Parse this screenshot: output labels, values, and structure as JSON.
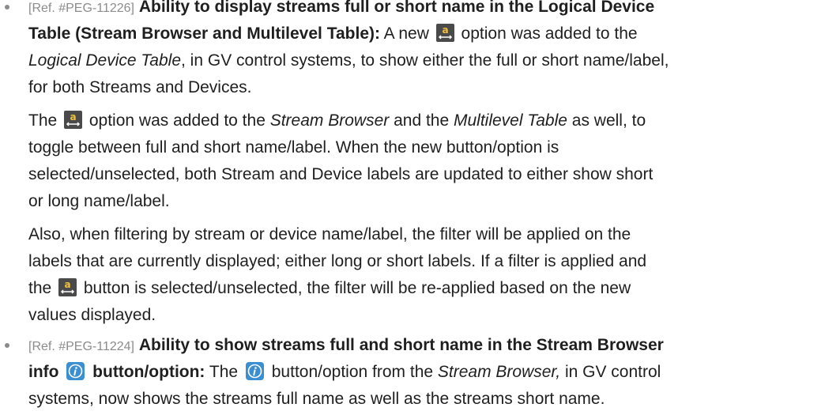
{
  "items": [
    {
      "ref": "[Ref. #PEG-11226]",
      "title_line1": "Ability to display streams full or short name in the Logical Device",
      "title_line2": "Table (Stream Browser and Multilevel Table):",
      "p1_l2_after_title_a": " A new ",
      "p1_l2_after_icon": " option was added to the",
      "p1_l3_italic": "Logical Device Table",
      "p1_l3_rest": ", in GV control systems, to show either the full or short name/label,",
      "p1_l4": "for both Streams and Devices.",
      "p2_l1_a": "The ",
      "p2_l1_b": " option was added to the ",
      "p2_l1_italic1": "Stream Browser",
      "p2_l1_c": " and the ",
      "p2_l1_italic2": "Multilevel Table",
      "p2_l1_d": " as well, to",
      "p2_l2": "toggle between full and short name/label. When the new button/option is",
      "p2_l3": "selected/unselected, both Stream and Device labels are updated to either show short",
      "p2_l4": "or long name/label.",
      "p3_l1": "Also, when filtering by stream or device name/label, the filter will be applied on the",
      "p3_l2": "labels that are currently displayed; either long or short labels. If a filter is applied and",
      "p3_l3_a": "the ",
      "p3_l3_b": " button is selected/unselected, the filter will be re-applied based on the new",
      "p3_l4": "values displayed."
    },
    {
      "ref": "[Ref. #PEG-11224]",
      "title_line1": "Ability to show streams full and short name in the Stream Browser",
      "title_line2_a": "info ",
      "title_line2_b": " button/option:",
      "l2_a": " The ",
      "l2_b": " button/option from the ",
      "l2_italic": "Stream Browser,",
      "l2_c": " in GV control",
      "l3": "systems, now shows the streams full name as well as the streams short name."
    }
  ],
  "icons": {
    "label_toggle": "short-long-label-icon",
    "info": "info-icon",
    "info_color": "#3b8fd1",
    "label_toggle_color": "#4a4a4a"
  }
}
